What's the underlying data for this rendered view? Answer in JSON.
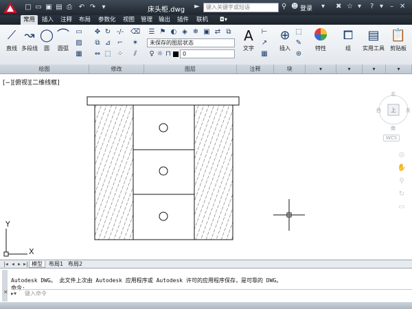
{
  "titlebar": {
    "document_title": "床头柜.dwg",
    "search_placeholder": "键入关键字或短语",
    "login_label": "登录",
    "app_button_icon": "autocad-logo-icon"
  },
  "ribbon": {
    "tabs": [
      "常用",
      "插入",
      "注释",
      "布局",
      "参数化",
      "视图",
      "管理",
      "输出",
      "插件",
      "联机"
    ],
    "active_tab": "常用",
    "draw_tools": [
      "直线",
      "多段线",
      "圆",
      "圆弧"
    ],
    "panels": [
      "绘图",
      "修改",
      "图层",
      "注释",
      "块",
      "特性",
      "组",
      "实用工具",
      "剪贴板"
    ],
    "layer_state": "未保存的图层状态",
    "current_layer": "0",
    "text_label": "文字",
    "insert_label": "插入",
    "properties_label": "特性",
    "group_label": "组",
    "utilities_label": "实用工具",
    "clipboard_label": "剪贴板"
  },
  "viewport": {
    "label": "[−][俯视][二维线框]",
    "viewcube": {
      "top_label": "上",
      "north": "北",
      "south": "南",
      "west": "西",
      "east": "东",
      "wcs": "WCS"
    },
    "ucs": {
      "x": "X",
      "y": "Y"
    }
  },
  "layout_tabs": [
    "模型",
    "布局1",
    "布局2"
  ],
  "command": {
    "history": [
      "Autodesk DWG。  此文件上次由 Autodesk 应用程序或 Autodesk 许可的应用程序保存，是可靠的 DWG。",
      "命令:"
    ],
    "placeholder": "键入命令"
  },
  "colors": {
    "accent": "#c8102e",
    "ribbon_dark": "#2b343e"
  }
}
